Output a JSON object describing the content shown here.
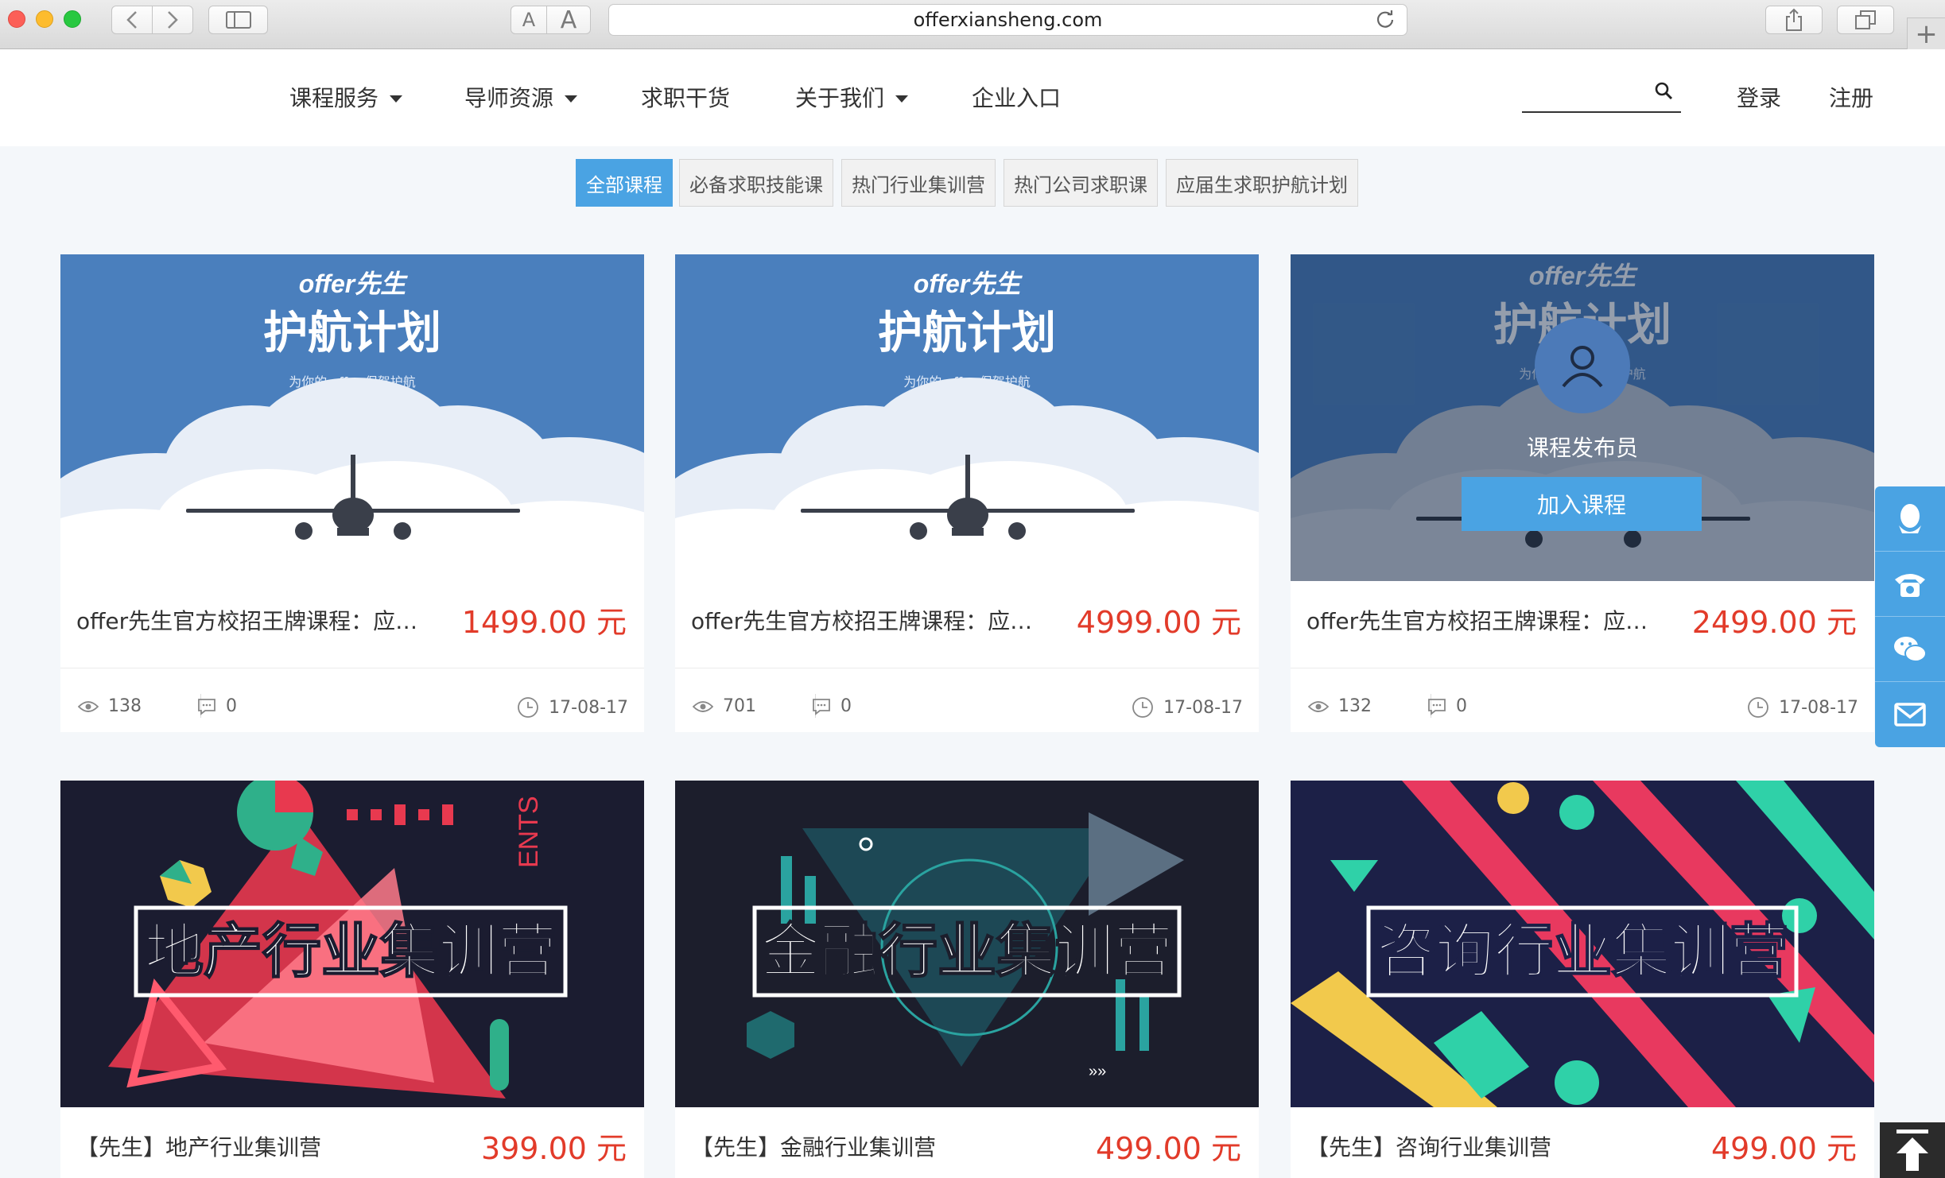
{
  "browser": {
    "url": "offerxiansheng.com",
    "font_small_label": "A",
    "font_large_label": "A",
    "new_tab_label": "+"
  },
  "nav": {
    "items": [
      {
        "label": "课程服务",
        "dropdown": true
      },
      {
        "label": "导师资源",
        "dropdown": true
      },
      {
        "label": "求职干货",
        "dropdown": false
      },
      {
        "label": "关于我们",
        "dropdown": true
      },
      {
        "label": "企业入口",
        "dropdown": false
      }
    ],
    "search_value": "",
    "login": "登录",
    "register": "注册"
  },
  "categories": [
    {
      "label": "全部课程",
      "active": true
    },
    {
      "label": "必备求职技能课",
      "active": false
    },
    {
      "label": "热门行业集训营",
      "active": false
    },
    {
      "label": "热门公司求职课",
      "active": false
    },
    {
      "label": "应届生求职护航计划",
      "active": false
    }
  ],
  "courses": [
    {
      "title": "offer先生官方校招王牌课程：应…",
      "price": "1499.00 元",
      "views": "138",
      "comments": "0",
      "date": "17-08-17"
    },
    {
      "title": "offer先生官方校招王牌课程：应…",
      "price": "4999.00 元",
      "views": "701",
      "comments": "0",
      "date": "17-08-17"
    },
    {
      "title": "offer先生官方校招王牌课程：应…",
      "price": "2499.00 元",
      "views": "132",
      "comments": "0",
      "date": "17-08-17",
      "overlay": {
        "publisher": "课程发布员",
        "join_label": "加入课程"
      }
    },
    {
      "title": "【先生】地产行业集训营",
      "price": "399.00 元",
      "banner": "地产行业集训营"
    },
    {
      "title": "【先生】金融行业集训营",
      "price": "499.00 元",
      "banner": "金融行业集训营"
    },
    {
      "title": "【先生】咨询行业集训营",
      "price": "499.00 元",
      "banner": "咨询行业集训营"
    }
  ],
  "hero_art": {
    "logo": "offer先生",
    "headline": "护航计划",
    "tagline": "为你的 offer 保驾护航"
  },
  "colors": {
    "accent": "#4aa3e3",
    "price": "#e23b2a",
    "hero_blue": "#4a7fbd",
    "dark_banner": "#1c1e33"
  }
}
